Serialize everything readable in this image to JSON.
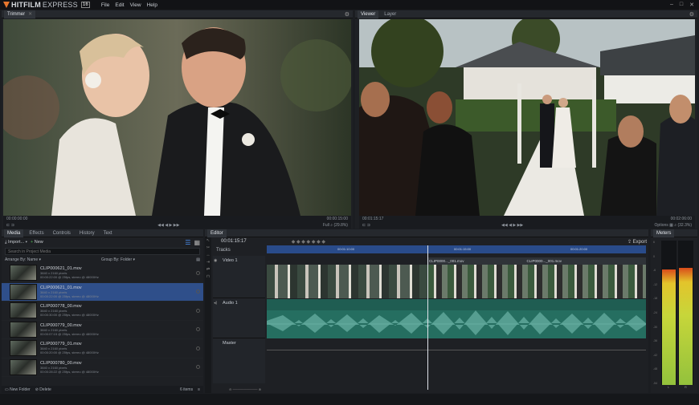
{
  "app": {
    "brand": "HITFILM",
    "brand_suffix": "EXPRESS",
    "version_badge": "16",
    "menus": [
      "File",
      "Edit",
      "View",
      "Help"
    ]
  },
  "trimmer": {
    "tab": "Trimmer",
    "time_left": "00:00:00:00",
    "time_right": "00:00:15:00",
    "zoom_label": "Full",
    "zoom_value": "(29.8%)"
  },
  "viewer": {
    "tabs": [
      "Viewer",
      "Layer"
    ],
    "time_left": "00:01:15:17",
    "time_right": "00:02:06:00",
    "options_label": "Options",
    "zoom_label": "Full",
    "zoom_value": "(32.3%)"
  },
  "media_panel": {
    "tabs": [
      "Media",
      "Effects",
      "Controls",
      "History",
      "Text"
    ],
    "import_label": "Import...",
    "new_label": "New",
    "search_placeholder": "Search in Project Media",
    "arrange_label": "Arrange By: Name",
    "group_label": "Group By: Folder",
    "items": [
      {
        "name": "CLIP000621_01.mov",
        "meta1": "3840 x 2160 pixels",
        "meta2": "00:00:22:00 @ 25fps, stereo @ 48000Hz"
      },
      {
        "name": "CLIP000621_01.mov",
        "meta1": "3840 x 2160 pixels",
        "meta2": "00:00:22:00 @ 25fps, stereo @ 48000Hz"
      },
      {
        "name": "CLIP000778_00.mov",
        "meta1": "3840 x 2160 pixels",
        "meta2": "00:00:30:00 @ 25fps, stereo @ 48000Hz"
      },
      {
        "name": "CLIP000779_00.mov",
        "meta1": "3840 x 2160 pixels",
        "meta2": "00:00:07:15 @ 25fps, stereo @ 48000Hz"
      },
      {
        "name": "CLIP000779_01.mov",
        "meta1": "3840 x 2160 pixels",
        "meta2": "00:00:20:00 @ 25fps, stereo @ 48000Hz"
      },
      {
        "name": "CLIP000780_00.mov",
        "meta1": "3840 x 2160 pixels",
        "meta2": "00:00:28:22 @ 25fps, stereo @ 48000Hz"
      }
    ],
    "new_folder_label": "New Folder",
    "delete_label": "Delete",
    "items_count": "6 items"
  },
  "editor": {
    "tab": "Editor",
    "timecode": "00:01:15:17",
    "export_label": "Export",
    "tracks_label": "Tracks",
    "ruler": [
      "00:01:10:00",
      "00:01:15:00",
      "00:01:20:00"
    ],
    "video_track": "Video 1",
    "audio_track": "Audio 1",
    "master_track": "Master",
    "clip_labels": [
      "CLIP0000..._001.mov",
      "CLIP0000..._001.mov"
    ]
  },
  "meters": {
    "tab": "Meters",
    "scale": [
      "6",
      "0",
      "-6",
      "-12",
      "-18",
      "-24",
      "-30",
      "-36",
      "-42",
      "-48",
      "-54"
    ],
    "channels": [
      "L",
      "R"
    ],
    "level_left": 0.8,
    "level_right": 0.81
  },
  "colors": {
    "accent": "#e8772e",
    "selection": "#2f4f8a",
    "audio": "#256e60",
    "playhead": "#dfe3ea"
  }
}
